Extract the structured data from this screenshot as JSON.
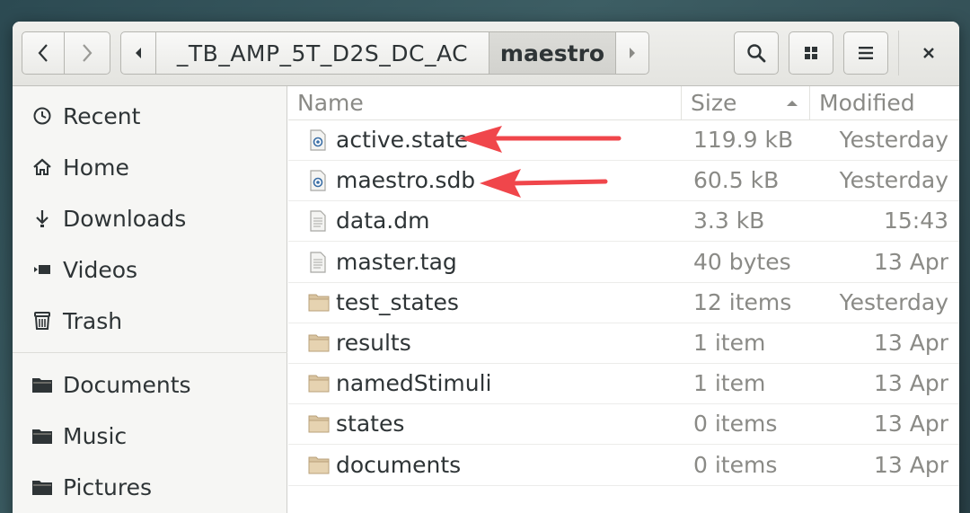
{
  "window": {
    "path_segments": [
      "_TB_AMP_5T_D2S_DC_AC",
      "maestro"
    ]
  },
  "sidebar": {
    "items": [
      {
        "label": "Recent",
        "icon": "clock-icon"
      },
      {
        "label": "Home",
        "icon": "home-icon"
      },
      {
        "label": "Downloads",
        "icon": "download-icon"
      },
      {
        "label": "Videos",
        "icon": "video-icon"
      },
      {
        "label": "Trash",
        "icon": "trash-icon"
      },
      {
        "label": "Documents",
        "icon": "folder-icon"
      },
      {
        "label": "Music",
        "icon": "folder-icon"
      },
      {
        "label": "Pictures",
        "icon": "folder-icon"
      }
    ]
  },
  "columns": {
    "name": "Name",
    "size": "Size",
    "modified": "Modified"
  },
  "files": [
    {
      "name": "active.state",
      "size": "119.9 kB",
      "modified": "Yesterday",
      "type": "special-file"
    },
    {
      "name": "maestro.sdb",
      "size": "60.5 kB",
      "modified": "Yesterday",
      "type": "special-file"
    },
    {
      "name": "data.dm",
      "size": "3.3 kB",
      "modified": "15:43",
      "type": "text-file"
    },
    {
      "name": "master.tag",
      "size": "40 bytes",
      "modified": "13 Apr",
      "type": "text-file"
    },
    {
      "name": "test_states",
      "size": "12 items",
      "modified": "Yesterday",
      "type": "folder"
    },
    {
      "name": "results",
      "size": "1 item",
      "modified": "13 Apr",
      "type": "folder"
    },
    {
      "name": "namedStimuli",
      "size": "1 item",
      "modified": "13 Apr",
      "type": "folder"
    },
    {
      "name": "states",
      "size": "0 items",
      "modified": "13 Apr",
      "type": "folder"
    },
    {
      "name": "documents",
      "size": "0 items",
      "modified": "13 Apr",
      "type": "folder"
    }
  ],
  "colors": {
    "annotation_arrow": "#f0464b",
    "folder": "#d9c4a0"
  }
}
